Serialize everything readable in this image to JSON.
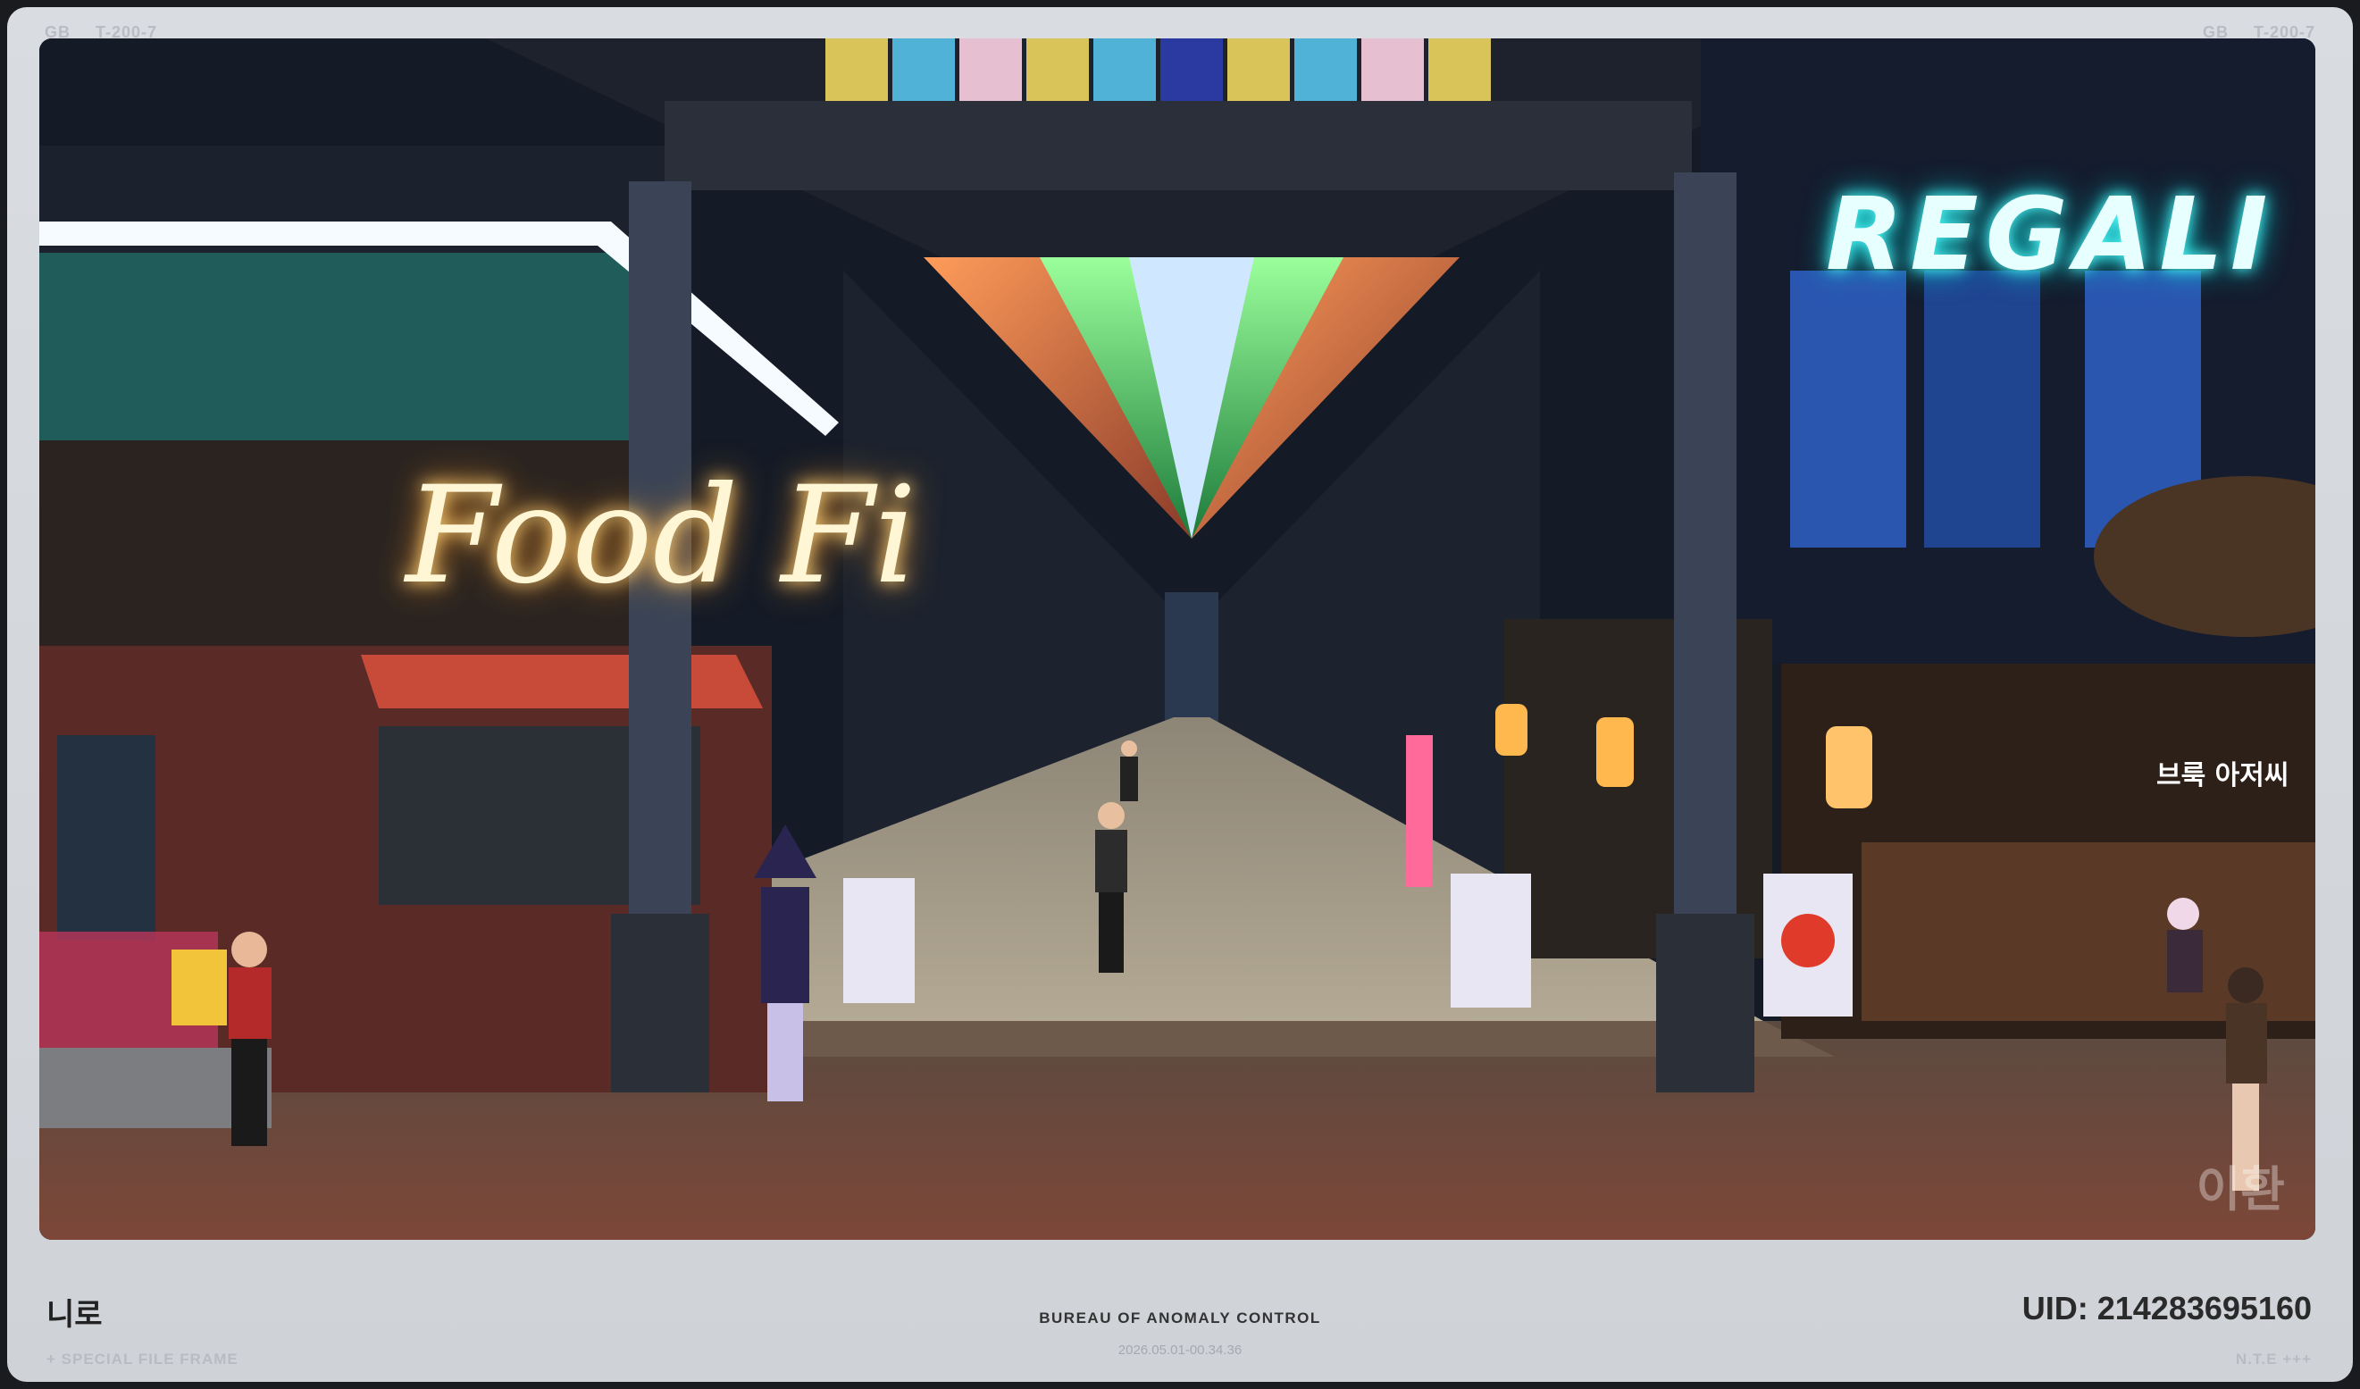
{
  "frame": {
    "corner_left_code": "GB",
    "corner_left_id": "T-200-7",
    "corner_right_code": "GB",
    "corner_right_id": "T-200-7"
  },
  "scene": {
    "neon_food": "Food Fi",
    "neon_regal": "REGALI",
    "stall_sign": "브룩 아저씨",
    "watermark": "이환"
  },
  "footer": {
    "player_name": "니로",
    "special_label": "+ SPECIAL FILE FRAME",
    "organization": "BUREAU OF ANOMALY CONTROL",
    "timestamp": "2026.05.01-00.34.36",
    "uid": "UID: 214283695160",
    "brand": "N.T.E +++"
  },
  "colors": {
    "frame_bg": "#d5d8dc",
    "neon_warm": "#ffd47a",
    "neon_cyan": "#55ffff",
    "floor_brick": "#7a4a3a"
  }
}
